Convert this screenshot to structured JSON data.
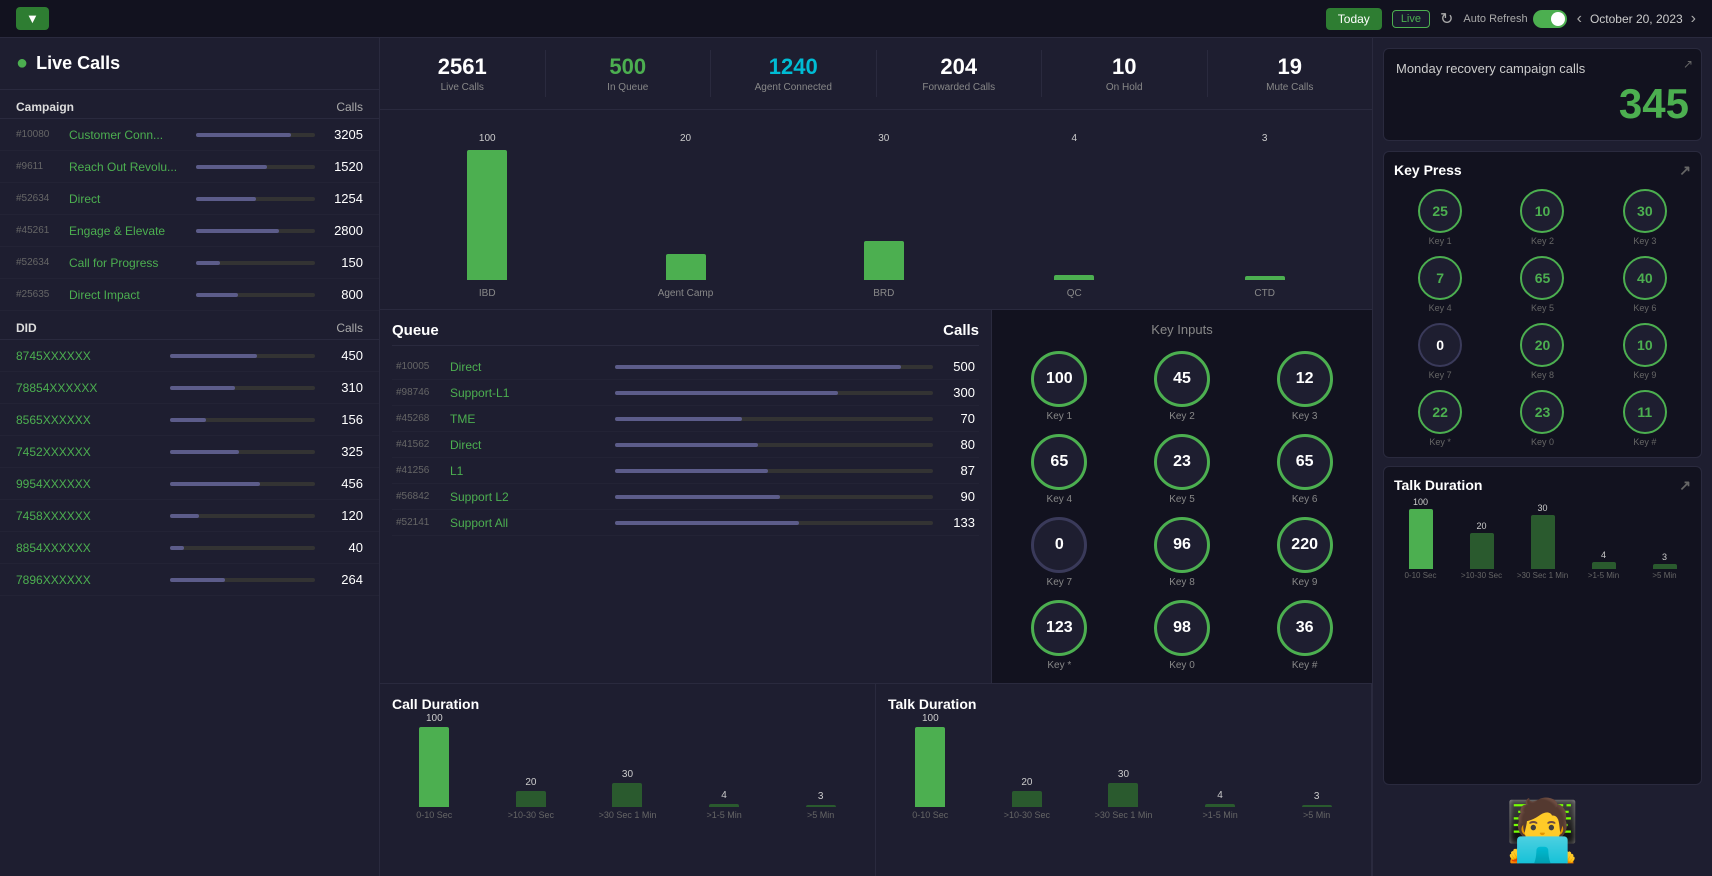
{
  "topbar": {
    "filter_icon": "▼",
    "today_label": "Today",
    "live_label": "Live",
    "refresh_label": "Auto Refresh",
    "date": "October 20, 2023"
  },
  "live_calls": {
    "title": "Live Calls",
    "sections": {
      "campaign": {
        "label": "Campaign",
        "calls_label": "Calls",
        "rows": [
          {
            "id": "#10080",
            "name": "Customer Conn...",
            "value": "3205",
            "bar": 80
          },
          {
            "id": "#9611",
            "name": "Reach Out Revolu...",
            "value": "1520",
            "bar": 60
          },
          {
            "id": "#52634",
            "name": "Direct",
            "value": "1254",
            "bar": 50
          },
          {
            "id": "#45261",
            "name": "Engage & Elevate",
            "value": "2800",
            "bar": 70
          },
          {
            "id": "#52634",
            "name": "Call for Progress",
            "value": "150",
            "bar": 20
          },
          {
            "id": "#25635",
            "name": "Direct Impact",
            "value": "800",
            "bar": 35
          }
        ]
      },
      "did": {
        "label": "DID",
        "calls_label": "Calls",
        "rows": [
          {
            "id": "",
            "name": "8745XXXXXX",
            "value": "450",
            "bar": 60
          },
          {
            "id": "",
            "name": "78854XXXXXX",
            "value": "310",
            "bar": 45
          },
          {
            "id": "",
            "name": "8565XXXXXX",
            "value": "156",
            "bar": 25
          },
          {
            "id": "",
            "name": "7452XXXXXX",
            "value": "325",
            "bar": 48
          },
          {
            "id": "",
            "name": "9954XXXXXX",
            "value": "456",
            "bar": 62
          },
          {
            "id": "",
            "name": "7458XXXXXX",
            "value": "120",
            "bar": 20
          },
          {
            "id": "",
            "name": "8854XXXXXX",
            "value": "40",
            "bar": 10
          },
          {
            "id": "",
            "name": "7896XXXXXX",
            "value": "264",
            "bar": 38
          }
        ]
      }
    }
  },
  "stats": {
    "live_calls": {
      "value": "2561",
      "label": "Live Calls"
    },
    "in_queue": {
      "value": "500",
      "label": "In Queue"
    },
    "agent_connected": {
      "value": "1240",
      "label": "Agent Connected"
    },
    "forwarded": {
      "value": "204",
      "label": "Forwarded Calls"
    },
    "on_hold": {
      "value": "10",
      "label": "On Hold"
    },
    "mute_calls": {
      "value": "19",
      "label": "Mute Calls"
    }
  },
  "top_chart": {
    "title": "",
    "bars": [
      {
        "label": "IBD",
        "value": 100,
        "secondary": 0
      },
      {
        "label": "Agent Camp",
        "value": 20,
        "secondary": 0
      },
      {
        "label": "BRD",
        "value": 30,
        "secondary": 0
      },
      {
        "label": "QC",
        "value": 4,
        "secondary": 0
      },
      {
        "label": "CTD",
        "value": 3,
        "secondary": 0
      }
    ]
  },
  "queue": {
    "title": "Queue",
    "calls_label": "Calls",
    "rows": [
      {
        "id": "#10005",
        "name": "Direct",
        "value": "500",
        "bar": 90
      },
      {
        "id": "#98746",
        "name": "Support-L1",
        "value": "300",
        "bar": 70
      },
      {
        "id": "#45268",
        "name": "TME",
        "value": "70",
        "bar": 40
      },
      {
        "id": "#41562",
        "name": "Direct",
        "value": "80",
        "bar": 45
      },
      {
        "id": "#41256",
        "name": "L1",
        "value": "87",
        "bar": 48
      },
      {
        "id": "#56842",
        "name": "Support L2",
        "value": "90",
        "bar": 52
      },
      {
        "id": "#52141",
        "name": "Support All",
        "value": "133",
        "bar": 58
      }
    ]
  },
  "key_inputs": {
    "title": "Key Inputs",
    "keys": [
      {
        "label": "Key 1",
        "value": "100",
        "active": true
      },
      {
        "label": "Key 2",
        "value": "45",
        "active": true
      },
      {
        "label": "Key 3",
        "value": "12",
        "active": true
      },
      {
        "label": "Key 4",
        "value": "65",
        "active": true
      },
      {
        "label": "Key 5",
        "value": "23",
        "active": true
      },
      {
        "label": "Key 6",
        "value": "65",
        "active": true
      },
      {
        "label": "Key 7",
        "value": "0",
        "active": false
      },
      {
        "label": "Key 8",
        "value": "96",
        "active": true
      },
      {
        "label": "Key 9",
        "value": "220",
        "active": true
      },
      {
        "label": "Key *",
        "value": "123",
        "active": true
      },
      {
        "label": "Key 0",
        "value": "98",
        "active": true
      },
      {
        "label": "Key #",
        "value": "36",
        "active": true
      }
    ]
  },
  "call_duration": {
    "title": "Call Duration",
    "bars": [
      {
        "label": "0-10 Sec",
        "value": 100,
        "pct": 100
      },
      {
        "label": ">10-30 Sec",
        "value": 20,
        "pct": 20
      },
      {
        "label": ">30 Sec 1 Min",
        "value": 30,
        "pct": 30
      },
      {
        "label": ">1-5 Min",
        "value": 4,
        "pct": 4
      },
      {
        "label": ">5 Min",
        "value": 3,
        "pct": 3
      }
    ]
  },
  "talk_duration_center": {
    "title": "Talk Duration",
    "bars": [
      {
        "label": "0-10 Sec",
        "value": 100,
        "pct": 100
      },
      {
        "label": ">10-30 Sec",
        "value": 20,
        "pct": 20
      },
      {
        "label": ">30 Sec 1 Min",
        "value": 30,
        "pct": 30
      },
      {
        "label": ">1-5 Min",
        "value": 4,
        "pct": 4
      },
      {
        "label": ">5 Min",
        "value": 3,
        "pct": 3
      }
    ]
  },
  "right_panel": {
    "campaign": {
      "name": "Monday recovery campaign calls",
      "count": "345"
    },
    "key_press": {
      "title": "Key Press",
      "keys": [
        {
          "label": "Key 1",
          "value": "25",
          "active": true
        },
        {
          "label": "Key 2",
          "value": "10",
          "active": true
        },
        {
          "label": "Key 3",
          "value": "30",
          "active": true
        },
        {
          "label": "Key 4",
          "value": "7",
          "active": true
        },
        {
          "label": "Key 5",
          "value": "65",
          "active": true
        },
        {
          "label": "Key 6",
          "value": "40",
          "active": true
        },
        {
          "label": "Key 7",
          "value": "0",
          "active": false
        },
        {
          "label": "Key 8",
          "value": "20",
          "active": true
        },
        {
          "label": "Key 9",
          "value": "10",
          "active": true
        },
        {
          "label": "Key *",
          "value": "22",
          "active": true
        },
        {
          "label": "Key 0",
          "value": "23",
          "active": true
        },
        {
          "label": "Key #",
          "value": "11",
          "active": true
        }
      ]
    },
    "talk_duration": {
      "title": "Talk Duration",
      "bars": [
        {
          "label": "0-10 Sec",
          "value": 100,
          "pct": 100
        },
        {
          "label": ">10-30 Sec",
          "value": 20,
          "pct": 60
        },
        {
          "label": ">30 Sec 1 Min",
          "value": 30,
          "pct": 90
        },
        {
          "label": ">1-5 Min",
          "value": 4,
          "pct": 12
        },
        {
          "label": ">5 Min",
          "value": 3,
          "pct": 9
        }
      ]
    }
  }
}
